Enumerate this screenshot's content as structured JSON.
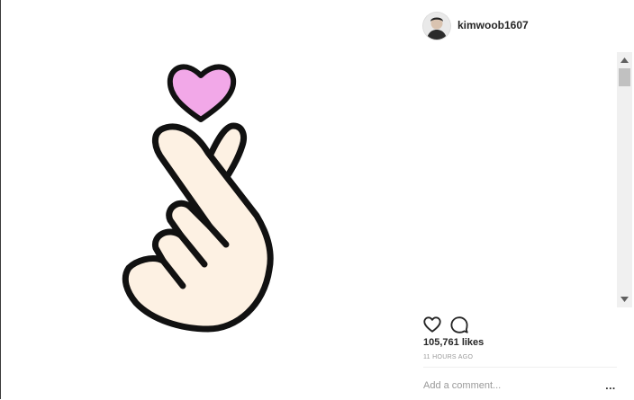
{
  "post": {
    "username": "kimwoob1607",
    "likes": "105,761 likes",
    "time": "11 HOURS AGO"
  },
  "comment": {
    "placeholder": "Add a comment...",
    "more_label": "..."
  },
  "icons": {
    "like": "heart-outline-icon",
    "comment": "speech-bubble-icon",
    "more": "ellipsis-icon",
    "scroll_up": "triangle-up-icon",
    "scroll_down": "triangle-down-icon"
  },
  "colors": {
    "heart_fill": "#f2a8e8",
    "hand_fill": "#fdf1e3",
    "outline": "#111111",
    "username": "#262626",
    "muted": "#999999",
    "scroll_track": "#f0f0f0",
    "scroll_thumb": "#c1c1c1"
  }
}
